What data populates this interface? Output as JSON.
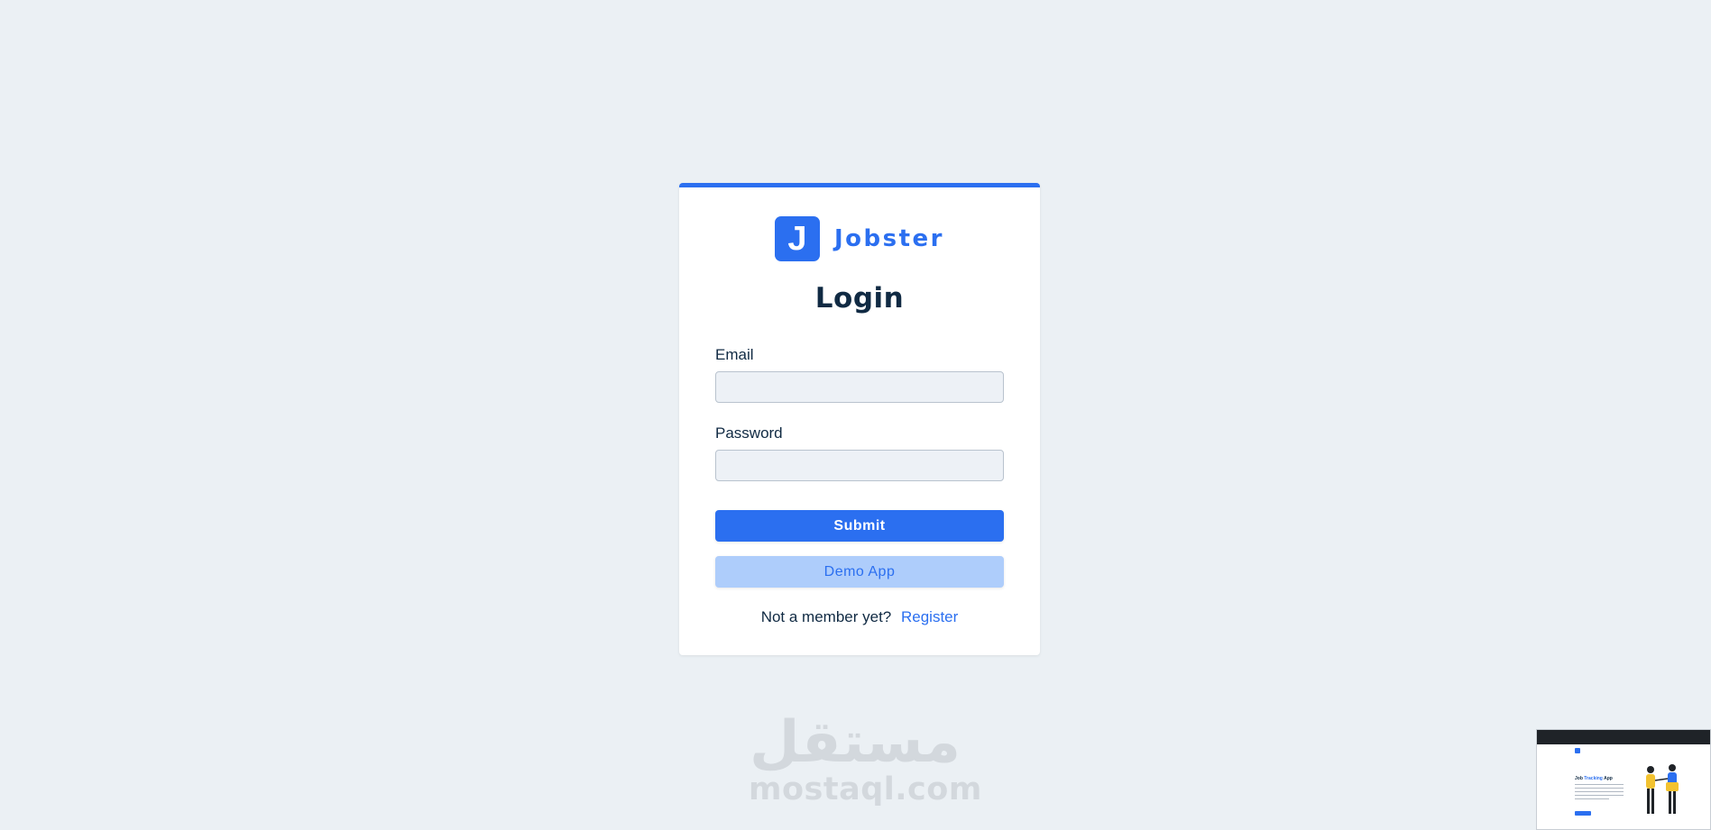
{
  "brand": {
    "logo_letter": "J",
    "name": "Jobster"
  },
  "form": {
    "title": "Login",
    "email": {
      "label": "Email",
      "value": "",
      "placeholder": ""
    },
    "password": {
      "label": "Password",
      "value": "",
      "placeholder": ""
    },
    "submit_label": "Submit",
    "demo_label": "Demo App",
    "footer_text": "Not a member yet?",
    "register_label": "Register"
  },
  "watermark": {
    "arabic": "مستقل",
    "domain": "mostaql.com"
  },
  "preview": {
    "heading_prefix": "Job",
    "heading_accent": "Tracking",
    "heading_suffix": "App"
  },
  "colors": {
    "accent": "#2b6ff0",
    "background": "#ebf0f4",
    "demo_bg": "#aecdfb",
    "text": "#102a43"
  }
}
